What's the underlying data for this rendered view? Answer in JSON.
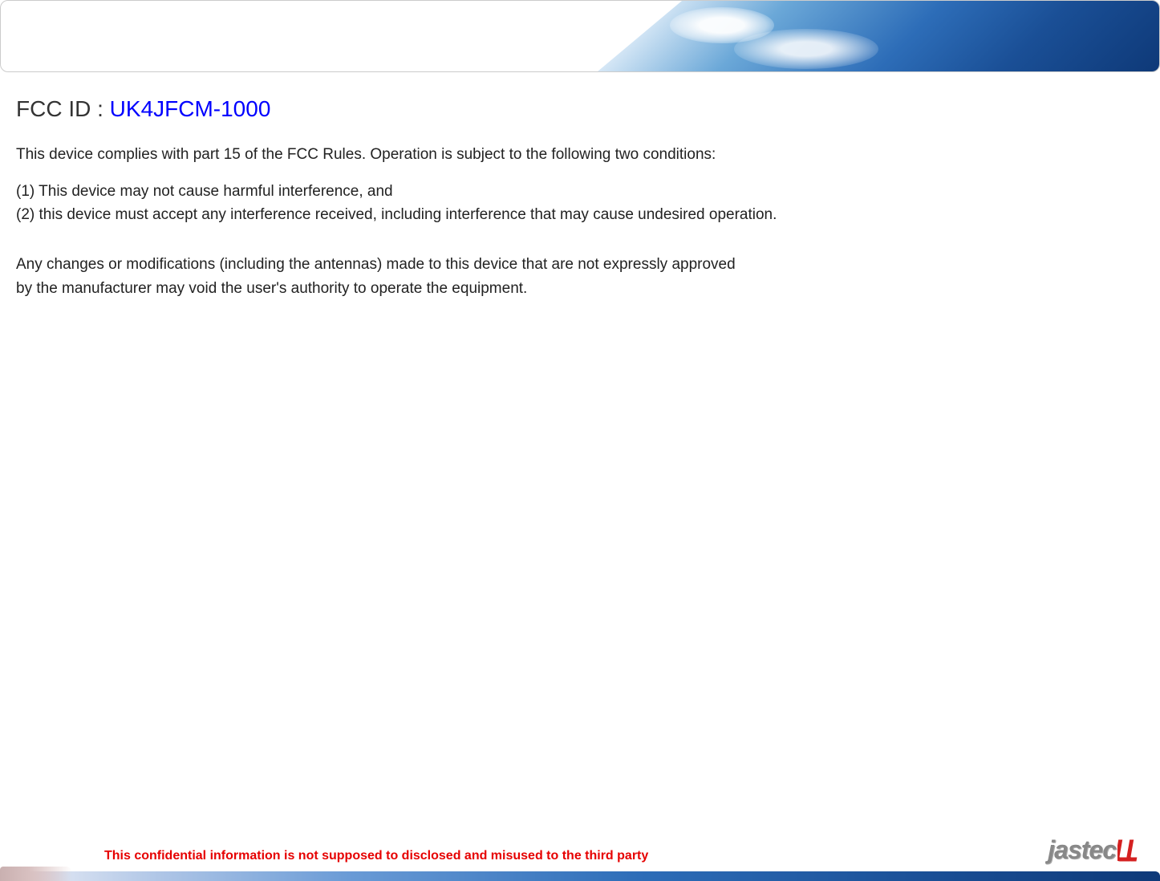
{
  "header": {
    "fcc_label": "FCC ID : ",
    "fcc_value": "UK4JFCM-1000"
  },
  "body": {
    "intro": "This device complies with part 15 of the FCC Rules. Operation is subject to the following two conditions:",
    "condition1": "(1) This device may not cause harmful interference, and",
    "condition2": "(2) this device must accept any interference received, including interference that may cause undesired operation.",
    "warning_line1": "Any changes or modifications (including the antennas) made to this device that are not expressly approved",
    "warning_line2": "by the manufacturer may void the user's authority to operate the equipment."
  },
  "footer": {
    "confidential": "This confidential information is not supposed to disclosed and misused to the third party",
    "logo_text": "jastec"
  }
}
